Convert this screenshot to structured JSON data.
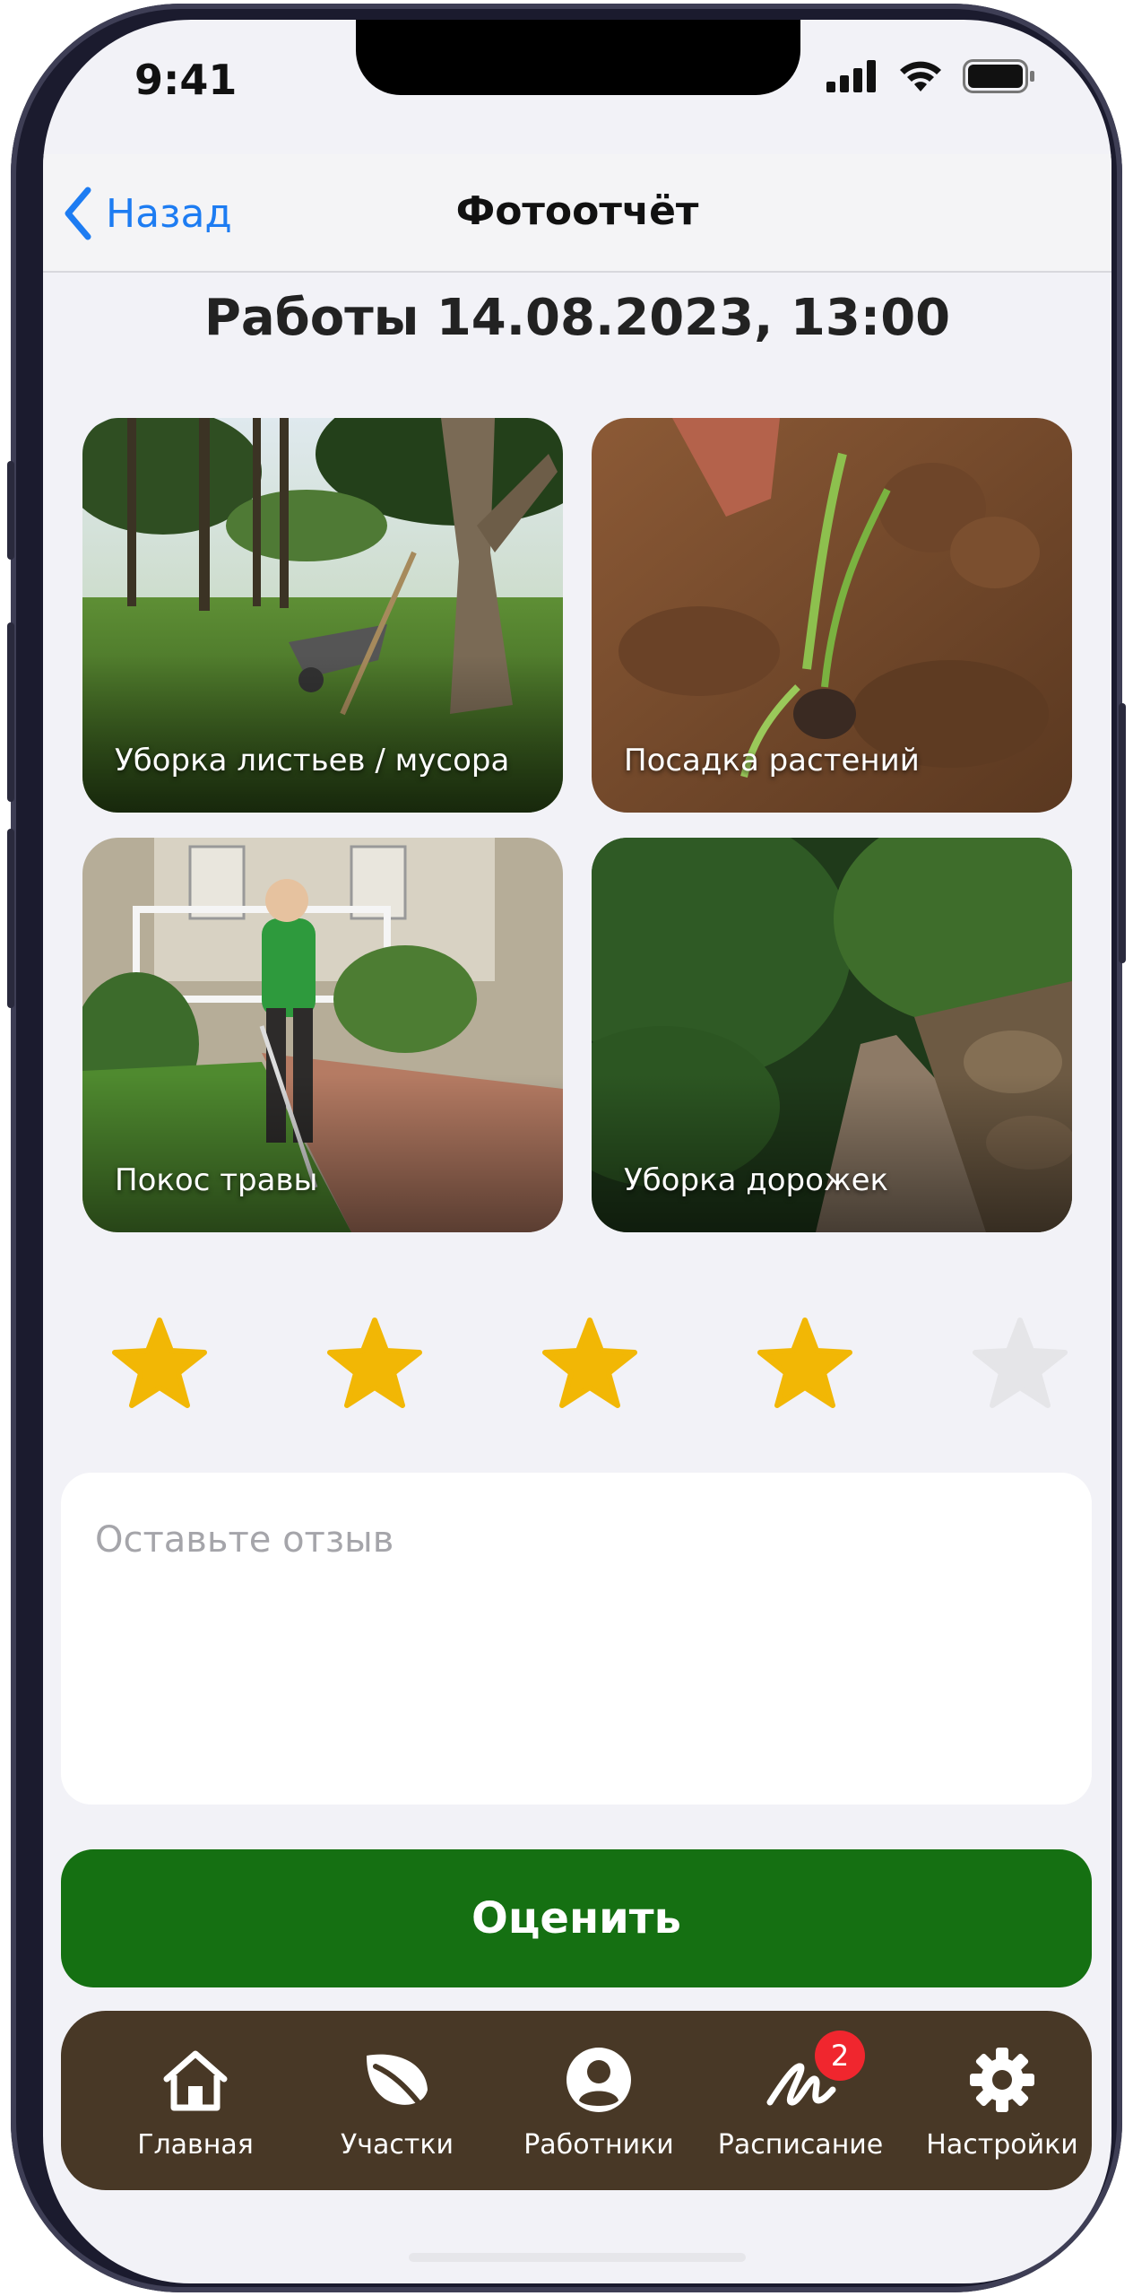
{
  "status_bar": {
    "time": "9:41"
  },
  "nav": {
    "back_label": "Назад",
    "title": "Фотоотчёт"
  },
  "report": {
    "heading": "Работы 14.08.2023, 13:00"
  },
  "photos": [
    {
      "caption": "Уборка листьев / мусора"
    },
    {
      "caption": "Посадка растений"
    },
    {
      "caption": "Покос травы"
    },
    {
      "caption": "Уборка дорожек"
    }
  ],
  "rating": {
    "value": 4,
    "max": 5,
    "filled_color": "#F2B705",
    "empty_color": "#E5E5E8"
  },
  "review": {
    "placeholder": "Оставьте отзыв",
    "value": ""
  },
  "submit": {
    "label": "Оценить",
    "color": "#157012"
  },
  "tab_bar": {
    "background": "#483826",
    "items": [
      {
        "label": "Главная",
        "icon": "home-icon"
      },
      {
        "label": "Участки",
        "icon": "leaf-icon"
      },
      {
        "label": "Работники",
        "icon": "person-circle-icon"
      },
      {
        "label": "Расписание",
        "icon": "signature-icon",
        "badge": "2"
      },
      {
        "label": "Настройки",
        "icon": "gear-icon"
      }
    ]
  }
}
